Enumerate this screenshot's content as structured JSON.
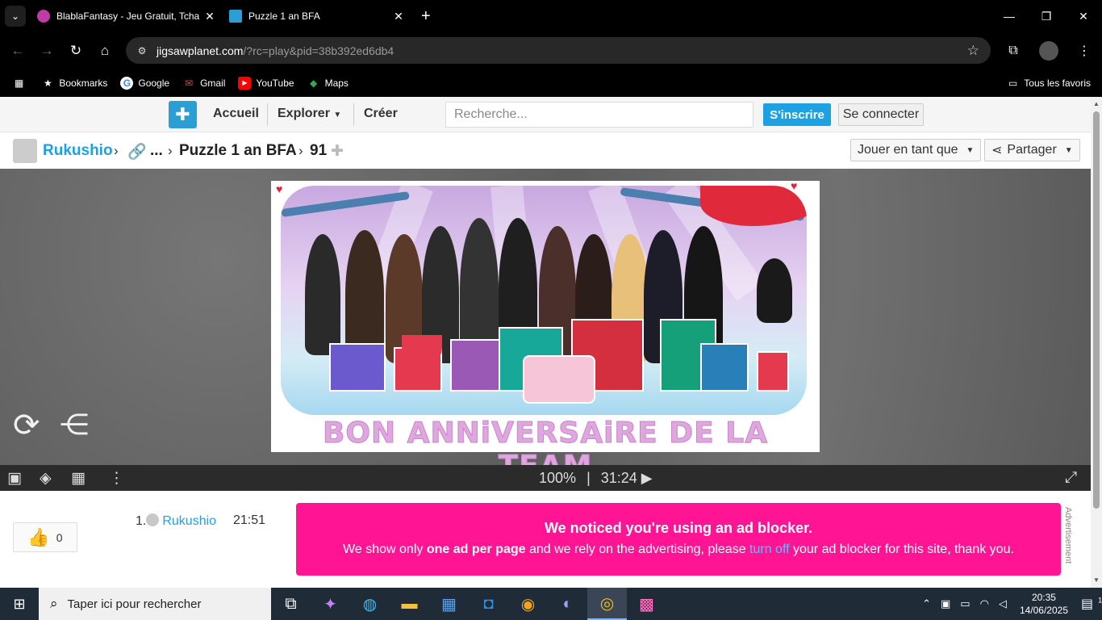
{
  "browser": {
    "tabs": [
      {
        "title": "BlablaFantasy - Jeu Gratuit, Tcha",
        "active": false
      },
      {
        "title": "Puzzle 1 an BFA",
        "active": true
      }
    ],
    "url_host": "jigsawplanet.com",
    "url_path": "/?rc=play&pid=38b392ed6db4",
    "bookmarks": [
      {
        "label": "Bookmarks",
        "icon": "star-icon"
      },
      {
        "label": "Google",
        "icon": "google-icon"
      },
      {
        "label": "Gmail",
        "icon": "gmail-icon"
      },
      {
        "label": "YouTube",
        "icon": "youtube-icon"
      },
      {
        "label": "Maps",
        "icon": "maps-icon"
      }
    ],
    "all_bookmarks": "Tous les favoris"
  },
  "site": {
    "nav": {
      "home": "Accueil",
      "explore": "Explorer",
      "create": "Créer"
    },
    "search_placeholder": "Recherche...",
    "signup": "S'inscrire",
    "login": "Se connecter"
  },
  "breadcrumb": {
    "user": "Rukushio",
    "ellipsis": "...",
    "puzzle": "Puzzle 1 an BFA",
    "pieces": "91"
  },
  "actions": {
    "play_as": "Jouer en tant que",
    "share": "Partager"
  },
  "puzzle": {
    "banner": "BON ANNiVERSAiRE DE LA TEAM"
  },
  "player_bar": {
    "progress": "100%",
    "separator": "|",
    "time": "31:24 ▶"
  },
  "likes": {
    "count": "0"
  },
  "scores": [
    {
      "rank": "1.",
      "user": "Rukushio",
      "time": "21:51"
    }
  ],
  "adblock": {
    "heading": "We noticed you're using an ad blocker.",
    "text_1": "We show only ",
    "text_bold": "one ad per page",
    "text_2": " and we rely on the advertising, please ",
    "link": "turn off",
    "text_3": " your ad blocker for this site, thank you.",
    "side_label": "Advertisement"
  },
  "taskbar": {
    "search_placeholder": "Taper ici pour rechercher",
    "time": "20:35",
    "date": "14/06/2025",
    "notif_count": "1"
  }
}
